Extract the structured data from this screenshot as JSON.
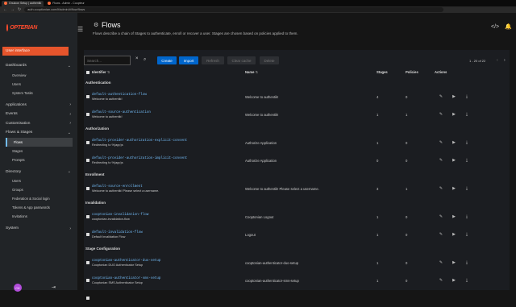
{
  "browser": {
    "tabs": [
      {
        "label": "Gnuicon Setup | authentik",
        "active": true
      },
      {
        "label": "Flows - Admin - Coopteur",
        "active": false
      }
    ],
    "url": "auth.cooptionian.com/if/admin/#/flow/flows"
  },
  "sidebar": {
    "logo_text": "OPTERIAN",
    "user_interface": "User interface",
    "dashboards": "Dashboards",
    "overview": "Overview",
    "users": "Users",
    "system_tasks": "System Tasks",
    "applications": "Applications",
    "events": "Events",
    "customisation": "Customisation",
    "flows_stages": "Flows & Stages",
    "flows": "Flows",
    "stages": "Stages",
    "prompts": "Prompts",
    "directory": "Directory",
    "dir_users": "Users",
    "groups": "Groups",
    "federation": "Federation & Social login",
    "tokens": "Tokens & App passwords",
    "invitations": "Invitations",
    "system": "System",
    "avatar": "CK"
  },
  "header": {
    "title": "Flows",
    "description": "Flows describe a chain of Stages to authenticate, enroll or recover a user. Stages are chosen based on policies applied to them."
  },
  "toolbar": {
    "search_placeholder": "Search...",
    "create": "Create",
    "import": "Import",
    "refresh": "Refresh",
    "clear_cache": "Clear cache",
    "delete": "Delete",
    "pagination": "1 - 20 of 22"
  },
  "table": {
    "headers": {
      "identifier": "Identifier",
      "name": "Name",
      "stages": "Stages",
      "policies": "Policies",
      "actions": "Actions"
    },
    "groups": [
      {
        "label": "Authentication",
        "rows": [
          {
            "slug": "default-authentication-flow",
            "sub": "Welcome to authentik!",
            "name": "Welcome to authentik!",
            "stages": "4",
            "policies": "0"
          },
          {
            "slug": "default-source-authentication",
            "sub": "Welcome to authentik!",
            "name": "Welcome to authentik!",
            "stages": "1",
            "policies": "1"
          }
        ]
      },
      {
        "label": "Authorization",
        "rows": [
          {
            "slug": "default-provider-authorization-explicit-consent",
            "sub": "Redirecting to %(app)s",
            "name": "Authorize Application",
            "stages": "1",
            "policies": "0"
          },
          {
            "slug": "default-provider-authorization-implicit-consent",
            "sub": "Redirecting to %(app)s",
            "name": "Authorize Application",
            "stages": "0",
            "policies": "0"
          }
        ]
      },
      {
        "label": "Enrollment",
        "rows": [
          {
            "slug": "default-source-enrollment",
            "sub": "Welcome to authentik! Please select a username.",
            "name": "Welcome to authentik! Please select a username.",
            "stages": "3",
            "policies": "1"
          }
        ]
      },
      {
        "label": "Invalidation",
        "rows": [
          {
            "slug": "cooptonian-invalidation-flow",
            "sub": "cooptonian-invalidation-flow",
            "name": "Cooptonian Logout",
            "stages": "1",
            "policies": "0"
          },
          {
            "slug": "default-invalidation-flow",
            "sub": "Default Invalidation Flow",
            "name": "Logout",
            "stages": "1",
            "policies": "0"
          }
        ]
      },
      {
        "label": "Stage Configuration",
        "rows": [
          {
            "slug": "cooptonian-authenticator-duo-setup",
            "sub": "Cooptonian DUO Authenticator Setup",
            "name": "cooptonian-authenticator-duo-setup",
            "stages": "1",
            "policies": "0"
          },
          {
            "slug": "cooptonian-authenticator-sms-setup",
            "sub": "Cooptonian SMS Authenticator Setup",
            "name": "cooptonian-authenticator-sms-setup",
            "stages": "1",
            "policies": "0"
          },
          {
            "slug": "",
            "sub": "",
            "name": "",
            "stages": "",
            "policies": ""
          }
        ]
      }
    ]
  }
}
